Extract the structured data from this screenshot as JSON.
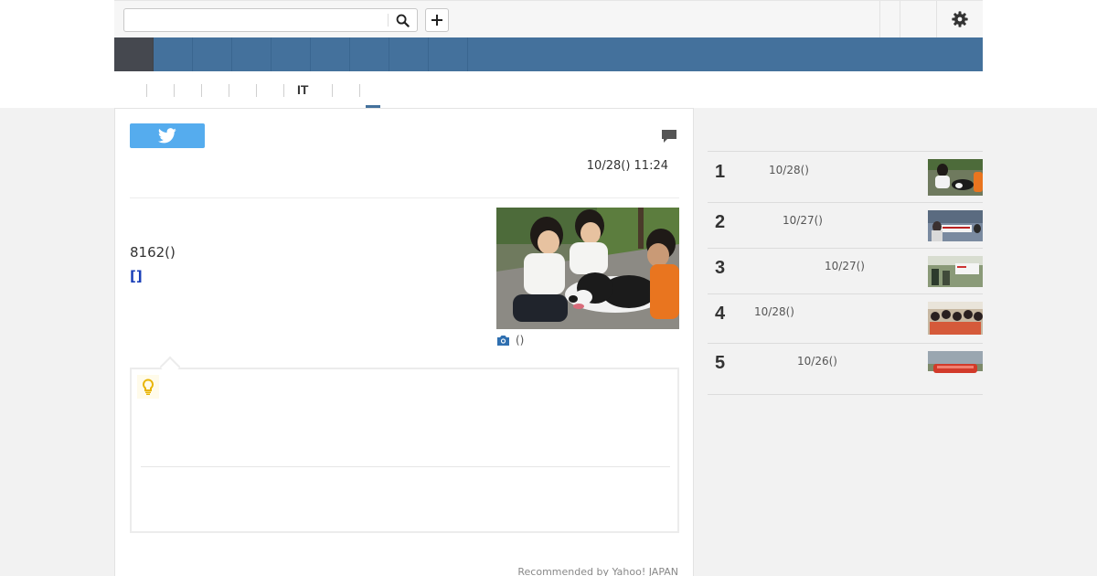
{
  "search": {
    "value": "",
    "placeholder": ""
  },
  "subnav": {
    "items": [
      "",
      "",
      "",
      "",
      "",
      "IT",
      ""
    ]
  },
  "article": {
    "date": "10/28() 11:24",
    "body_text": "8162()",
    "body_link": "[]",
    "photo_caption": "()",
    "photo_icon": "camera-icon",
    "tip_icon": "lightbulb-icon"
  },
  "recommend": "Recommended by Yahoo! JAPAN",
  "ranking": [
    {
      "rank": "1",
      "date": "10/28()"
    },
    {
      "rank": "2",
      "date": "10/27()"
    },
    {
      "rank": "3",
      "date": "10/27()"
    },
    {
      "rank": "4",
      "date": "10/28()"
    },
    {
      "rank": "5",
      "date": "10/26()"
    }
  ],
  "colors": {
    "nav_blue": "#44719c",
    "nav_active": "#45484f",
    "twitter_blue": "#55acee",
    "link_blue": "#1a3fb8",
    "tip_yellow": "#e8b400"
  }
}
